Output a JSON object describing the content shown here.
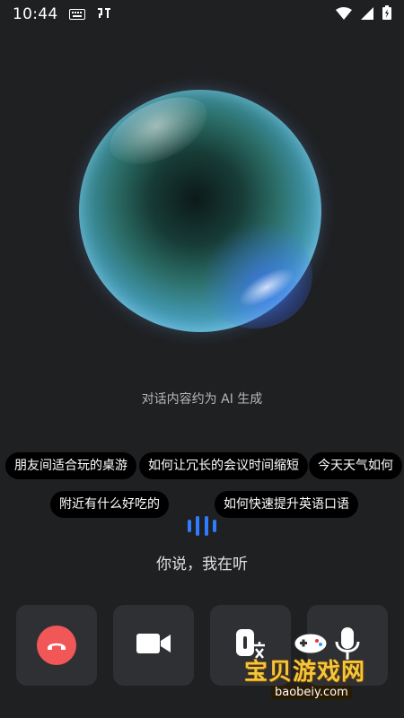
{
  "status_bar": {
    "time": "10:44"
  },
  "orb": {
    "primary_color": "#3f93a8",
    "accent_color": "#2f7cff"
  },
  "ai_notice": "对话内容约为 AI 生成",
  "suggestions": [
    {
      "label": "朋友间适合玩的桌游"
    },
    {
      "label": "如何让冗长的会议时间缩短"
    },
    {
      "label": "今天天气如何"
    },
    {
      "label": "附近有什么好吃的"
    },
    {
      "label": "如何快速提升英语口语"
    }
  ],
  "voice": {
    "status": "你说，我在听"
  },
  "controls": {
    "hangup_color": "#f25757",
    "buttons": [
      {
        "icon": "hangup-icon"
      },
      {
        "icon": "video-camera-icon"
      },
      {
        "icon": "translate-icon"
      },
      {
        "icon": "microphone-icon"
      }
    ]
  },
  "watermark": {
    "title": "宝贝游戏网",
    "url": "baobeiy.com"
  }
}
